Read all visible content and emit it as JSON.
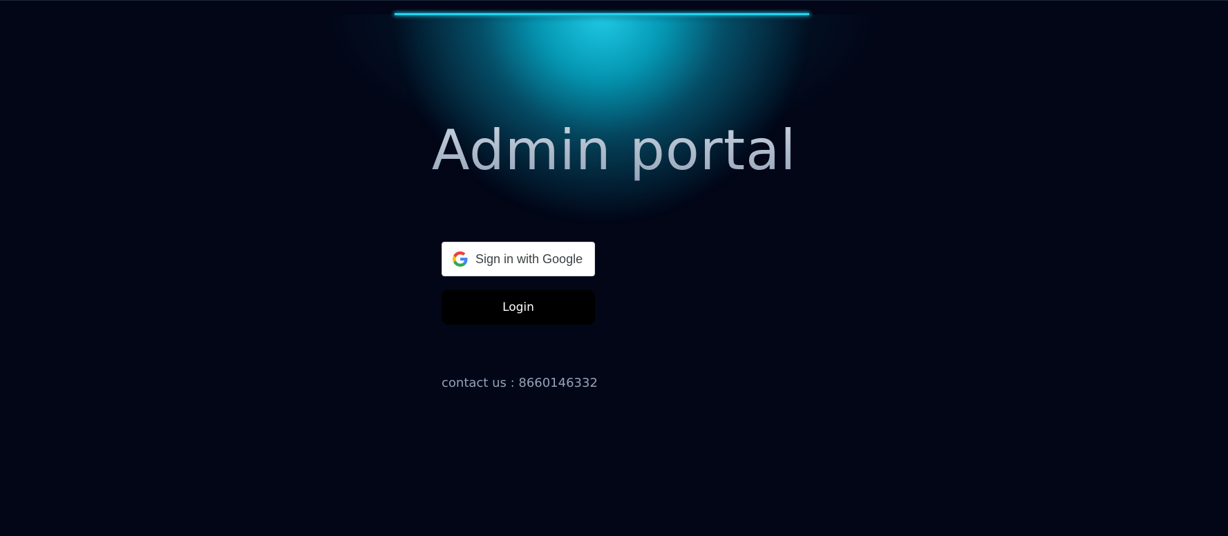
{
  "page": {
    "title": "Admin portal"
  },
  "auth": {
    "google_label": "Sign in with Google",
    "login_label": "Login"
  },
  "footer": {
    "contact_text": "contact us : 8660146332"
  },
  "icons": {
    "google": "google-logo-icon"
  },
  "colors": {
    "background": "#020617",
    "glow_accent": "#22d3ee",
    "title_text": "#a8b3c4",
    "login_button_bg": "#000000",
    "google_button_bg": "#ffffff",
    "contact_text": "#94a3b8"
  }
}
